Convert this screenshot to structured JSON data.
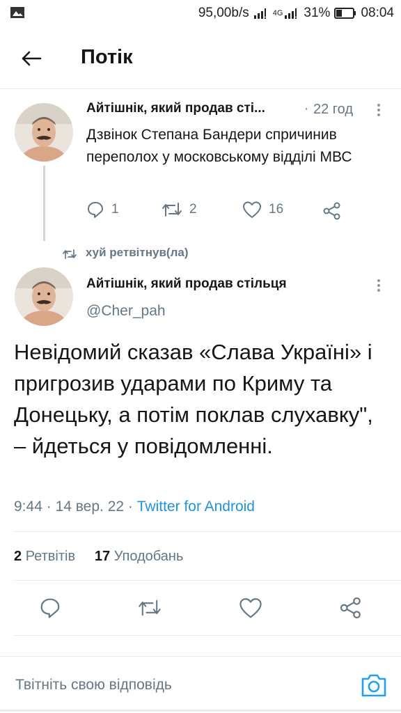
{
  "status_bar": {
    "speed": "95,00b/s",
    "network": "4G",
    "battery": "31%",
    "time": "08:04"
  },
  "header": {
    "title": "Потік"
  },
  "parent_tweet": {
    "author": "Айтішнік, який продав сті...",
    "separator": "·",
    "time": "22 год",
    "text": "Дзвінок Степана Бандери спричинив переполох у московському відділі МВС",
    "replies": "1",
    "retweets": "2",
    "likes": "16"
  },
  "retweet_context": {
    "label": "хуй ретвітнув(ла)"
  },
  "main_tweet": {
    "author": "Айтішнік, який продав стільця",
    "handle": "@Cher_pah",
    "text": "Невідомий сказав «Слава Україні» і пригрозив ударами по Криму та Донецьку, а потім поклав слухавку\", – йдеться у повідомленні.",
    "time": "9:44",
    "date": "14 вер. 22",
    "dot": "·",
    "source": "Twitter for Android",
    "retweets_count": "2",
    "retweets_label": "Ретвітів",
    "likes_count": "17",
    "likes_label": "Уподобань"
  },
  "reply_bar": {
    "placeholder": "Твітніть свою відповідь"
  },
  "colors": {
    "accent": "#1da1f2",
    "text": "#14171a",
    "secondary": "#657786",
    "link": "#1b95e0"
  }
}
